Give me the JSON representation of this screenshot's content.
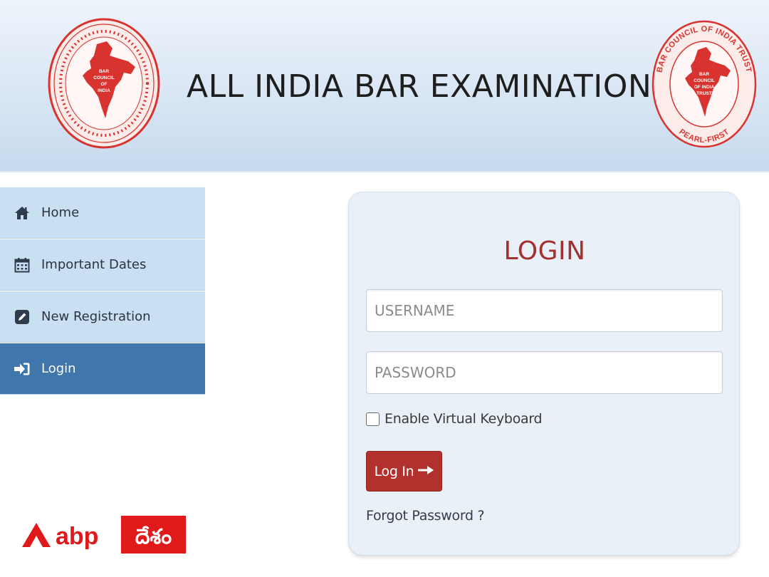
{
  "header": {
    "title": "ALL INDIA BAR EXAMINATION",
    "left_seal": {
      "icon": "bar-council-of-india-seal",
      "caption": [
        "BAR",
        "COUNCIL",
        "OF",
        "INDIA"
      ]
    },
    "right_seal": {
      "icon": "bar-council-of-india-trust-seal",
      "ring_text_top": "BAR COUNCIL OF INDIA TRUST",
      "ring_text_bottom": "PEARL-FIRST",
      "caption": [
        "BAR",
        "COUNCIL",
        "OF INDIA",
        "TRUST"
      ]
    }
  },
  "sidebar": {
    "items": [
      {
        "label": "Home",
        "icon": "home-icon",
        "active": false
      },
      {
        "label": "Important Dates",
        "icon": "calendar-icon",
        "active": false
      },
      {
        "label": "New Registration",
        "icon": "edit-icon",
        "active": false
      },
      {
        "label": "Login",
        "icon": "sign-in-icon",
        "active": true
      }
    ]
  },
  "login": {
    "title": "LOGIN",
    "username_placeholder": "USERNAME",
    "username_value": "",
    "password_placeholder": "PASSWORD",
    "password_value": "",
    "virtual_keyboard_label": "Enable Virtual Keyboard",
    "virtual_keyboard_checked": false,
    "button_label": "Log In",
    "button_icon": "arrow-right-icon",
    "forgot_label": "Forgot Password ?"
  },
  "watermark": {
    "brand": "abp",
    "brand_local": "దేశం"
  },
  "colors": {
    "header_bg": "#d9e6f4",
    "sidebar_bg": "#c9dff2",
    "sidebar_active": "#3f76ab",
    "card_bg": "#e9f0f8",
    "title_red": "#a3312f",
    "button_red": "#b2312c",
    "seal_red": "#d8332f"
  }
}
